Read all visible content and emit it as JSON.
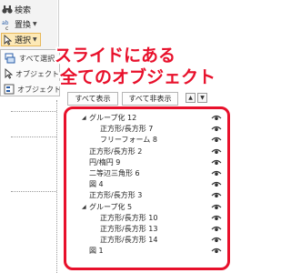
{
  "ribbon": {
    "search_label": "検索",
    "replace_label": "置換",
    "select_label": "選択"
  },
  "menu": {
    "items": [
      {
        "label": "すべて選択"
      },
      {
        "label": "オブジェクトの選択"
      },
      {
        "label": "オブジェクトの選択と表示"
      }
    ]
  },
  "annotation": {
    "line1": "スライドにある",
    "line2": "全てのオブジェクト",
    "color": "#e8102b"
  },
  "pane": {
    "show_all_label": "すべて表示",
    "hide_all_label": "すべて非表示",
    "items": [
      {
        "name": "グループ化 12",
        "group": true,
        "level": 0
      },
      {
        "name": "正方形/長方形 7",
        "group": false,
        "level": 1
      },
      {
        "name": "フリーフォーム 8",
        "group": false,
        "level": 1
      },
      {
        "name": "正方形/長方形 2",
        "group": false,
        "level": 0
      },
      {
        "name": "円/楕円 9",
        "group": false,
        "level": 0
      },
      {
        "name": "二等辺三角形 6",
        "group": false,
        "level": 0
      },
      {
        "name": "図 4",
        "group": false,
        "level": 0
      },
      {
        "name": "正方形/長方形 3",
        "group": false,
        "level": 0
      },
      {
        "name": "グループ化 5",
        "group": true,
        "level": 0
      },
      {
        "name": "正方形/長方形 10",
        "group": false,
        "level": 1
      },
      {
        "name": "正方形/長方形 13",
        "group": false,
        "level": 1
      },
      {
        "name": "正方形/長方形 14",
        "group": false,
        "level": 1
      },
      {
        "name": "図 1",
        "group": false,
        "level": 0
      }
    ]
  }
}
